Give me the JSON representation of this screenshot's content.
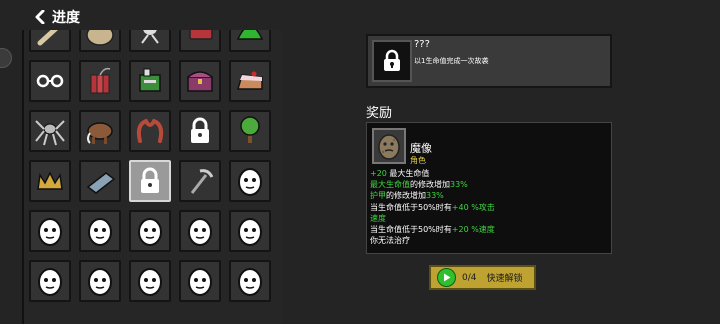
{
  "header": {
    "title": "进度"
  },
  "detail": {
    "name": "???",
    "description": "以1生命值完成一次故袭"
  },
  "reward": {
    "section_title": "奖励",
    "name": "魔像",
    "type": "角色",
    "effects": [
      [
        {
          "t": "+20",
          "c": "g"
        },
        {
          "t": " 最大生命值",
          "c": "w"
        }
      ],
      [
        {
          "t": "最大生命值",
          "c": "g"
        },
        {
          "t": "的修改增加",
          "c": "w"
        },
        {
          "t": "33%",
          "c": "g"
        }
      ],
      [
        {
          "t": "护甲",
          "c": "g"
        },
        {
          "t": "的修改增加",
          "c": "w"
        },
        {
          "t": "33%",
          "c": "g"
        }
      ],
      [
        {
          "t": "当生命值低于50%时有",
          "c": "w"
        },
        {
          "t": "+40 %攻击",
          "c": "g"
        }
      ],
      [
        {
          "t": "速度",
          "c": "g"
        }
      ],
      [
        {
          "t": "当生命值低于50%时有",
          "c": "w"
        },
        {
          "t": "+20 %速度",
          "c": "g"
        }
      ],
      [
        {
          "t": "你无法治疗",
          "c": "w"
        }
      ]
    ]
  },
  "unlock": {
    "progress": "0/4",
    "label": "快速解锁"
  },
  "grid": {
    "items": [
      "bone-item",
      "sack-item",
      "spider-item",
      "dynamite-item",
      "green-helmet-item",
      "glasses-item",
      "dynamite-bundle-item",
      "green-machine-item",
      "treasure-chest-item",
      "cake-slice-item",
      "robot-spider-item",
      "mammoth-item",
      "tentacle-item",
      "locked-item",
      "tree-item",
      "crown-item",
      "book-item",
      "locked-item",
      "pickaxe-item",
      "egg-character",
      "egg-character",
      "egg-character",
      "egg-character",
      "egg-character",
      "egg-character",
      "egg-character",
      "egg-character",
      "egg-character",
      "egg-character",
      "egg-character"
    ],
    "selected_index": 17
  },
  "colors": {
    "accent_green": "#3fd63f",
    "stat_yellow": "#e8d24a",
    "button_gold": "#bfa332"
  }
}
